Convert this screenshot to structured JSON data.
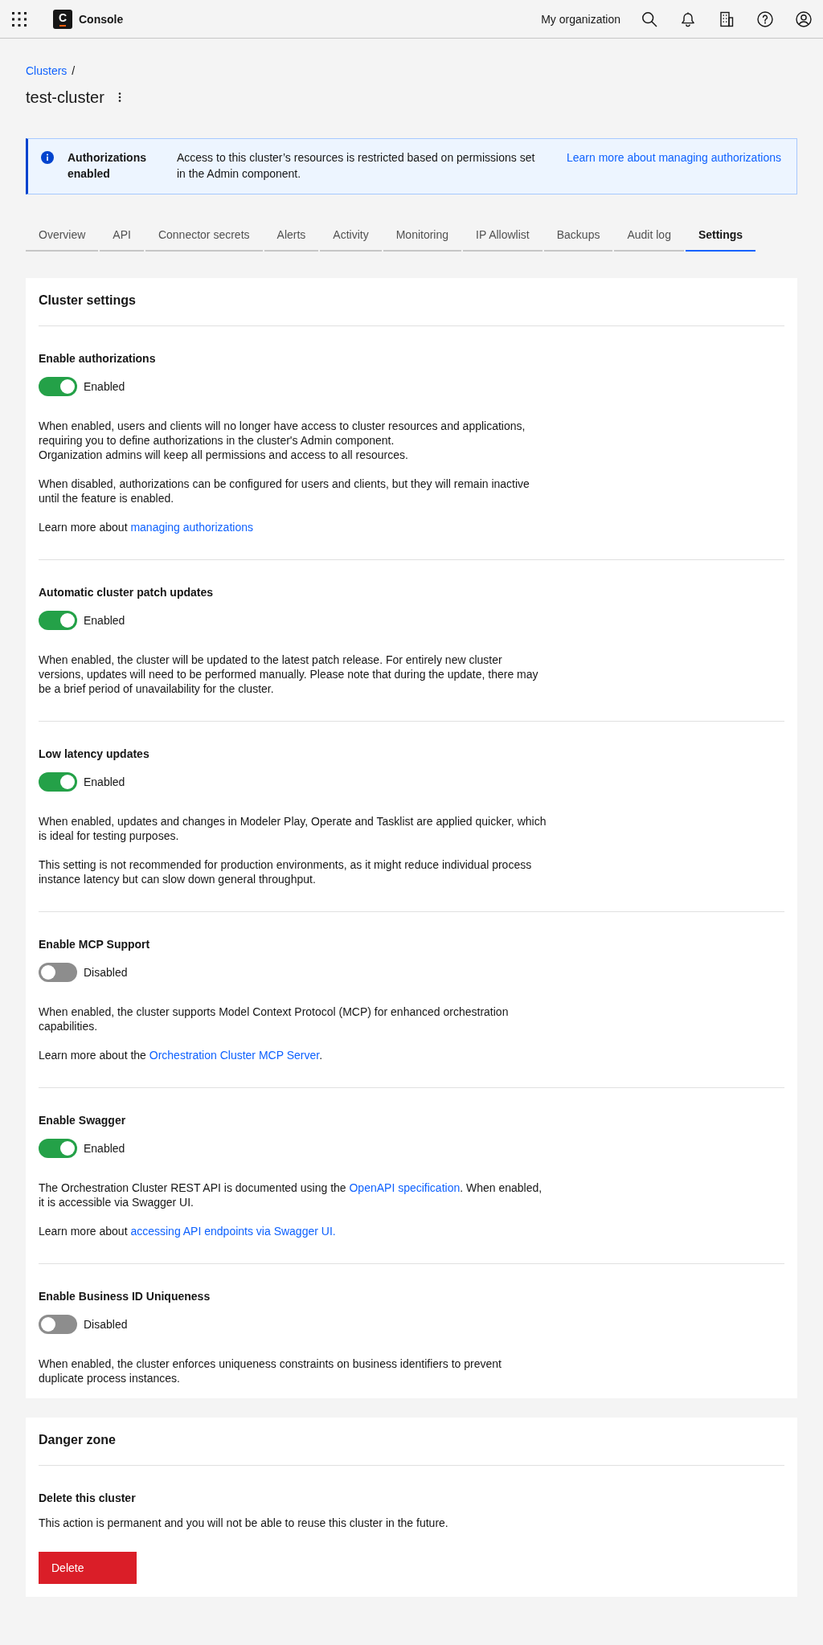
{
  "header": {
    "logo_letter": "C",
    "product": "Console",
    "organization": "My organization"
  },
  "breadcrumb": {
    "link": "Clusters",
    "separator": "/"
  },
  "page_title": "test-cluster",
  "banner": {
    "title": "Authorizations enabled",
    "message": "Access to this cluster’s resources is restricted based on permissions set in the Admin component.",
    "link": "Learn more about managing authorizations"
  },
  "tabs": [
    {
      "label": "Overview",
      "selected": false
    },
    {
      "label": "API",
      "selected": false
    },
    {
      "label": "Connector secrets",
      "selected": false
    },
    {
      "label": "Alerts",
      "selected": false
    },
    {
      "label": "Activity",
      "selected": false
    },
    {
      "label": "Monitoring",
      "selected": false
    },
    {
      "label": "IP Allowlist",
      "selected": false
    },
    {
      "label": "Backups",
      "selected": false
    },
    {
      "label": "Audit log",
      "selected": false
    },
    {
      "label": "Settings",
      "selected": true
    }
  ],
  "settings": {
    "title": "Cluster settings",
    "sections": [
      {
        "title": "Enable authorizations",
        "on": true,
        "status": "Enabled",
        "paragraphs": [
          [
            {
              "kind": "text",
              "text": "When enabled, users and clients will no longer have access to cluster resources and applications, requiring you to define authorizations in the cluster's Admin component.\nOrganization admins will keep all permissions and access to all resources."
            }
          ],
          [
            {
              "kind": "text",
              "text": "When disabled, authorizations can be configured for users and clients, but they will remain inactive until the feature is enabled."
            }
          ],
          [
            {
              "kind": "text",
              "text": "Learn more about "
            },
            {
              "kind": "link",
              "text": "managing authorizations"
            }
          ]
        ]
      },
      {
        "title": "Automatic cluster patch updates",
        "on": true,
        "status": "Enabled",
        "paragraphs": [
          [
            {
              "kind": "text",
              "text": "When enabled, the cluster will be updated to the latest patch release. For entirely new cluster versions, updates will need to be performed manually. Please note that during the update, there may be a brief period of unavailability for the cluster."
            }
          ]
        ]
      },
      {
        "title": "Low latency updates",
        "on": true,
        "status": "Enabled",
        "paragraphs": [
          [
            {
              "kind": "text",
              "text": "When enabled, updates and changes in Modeler Play, Operate and Tasklist are applied quicker, which is ideal for testing purposes."
            }
          ],
          [
            {
              "kind": "text",
              "text": "This setting is not recommended for production environments, as it might reduce individual process instance latency but can slow down general throughput."
            }
          ]
        ]
      },
      {
        "title": "Enable MCP Support",
        "on": false,
        "status": "Disabled",
        "paragraphs": [
          [
            {
              "kind": "text",
              "text": "When enabled, the cluster supports Model Context Protocol (MCP) for enhanced orchestration capabilities."
            }
          ],
          [
            {
              "kind": "text",
              "text": "Learn more about the "
            },
            {
              "kind": "link",
              "text": "Orchestration Cluster MCP Server"
            },
            {
              "kind": "text",
              "text": "."
            }
          ]
        ]
      },
      {
        "title": "Enable Swagger",
        "on": true,
        "status": "Enabled",
        "paragraphs": [
          [
            {
              "kind": "text",
              "text": "The Orchestration Cluster REST API is documented using the "
            },
            {
              "kind": "link",
              "text": "OpenAPI specification"
            },
            {
              "kind": "text",
              "text": ". When enabled, it is accessible via Swagger UI."
            }
          ],
          [
            {
              "kind": "text",
              "text": "Learn more about "
            },
            {
              "kind": "link",
              "text": "accessing API endpoints via Swagger UI."
            }
          ]
        ]
      },
      {
        "title": "Enable Business ID Uniqueness",
        "on": false,
        "status": "Disabled",
        "paragraphs": [
          [
            {
              "kind": "text",
              "text": "When enabled, the cluster enforces uniqueness constraints on business identifiers to prevent duplicate process instances."
            }
          ]
        ]
      }
    ]
  },
  "danger_zone": {
    "title": "Danger zone",
    "item_title": "Delete this cluster",
    "description": "This action is permanent and you will not be able to reuse this cluster in the future.",
    "button": "Delete"
  }
}
